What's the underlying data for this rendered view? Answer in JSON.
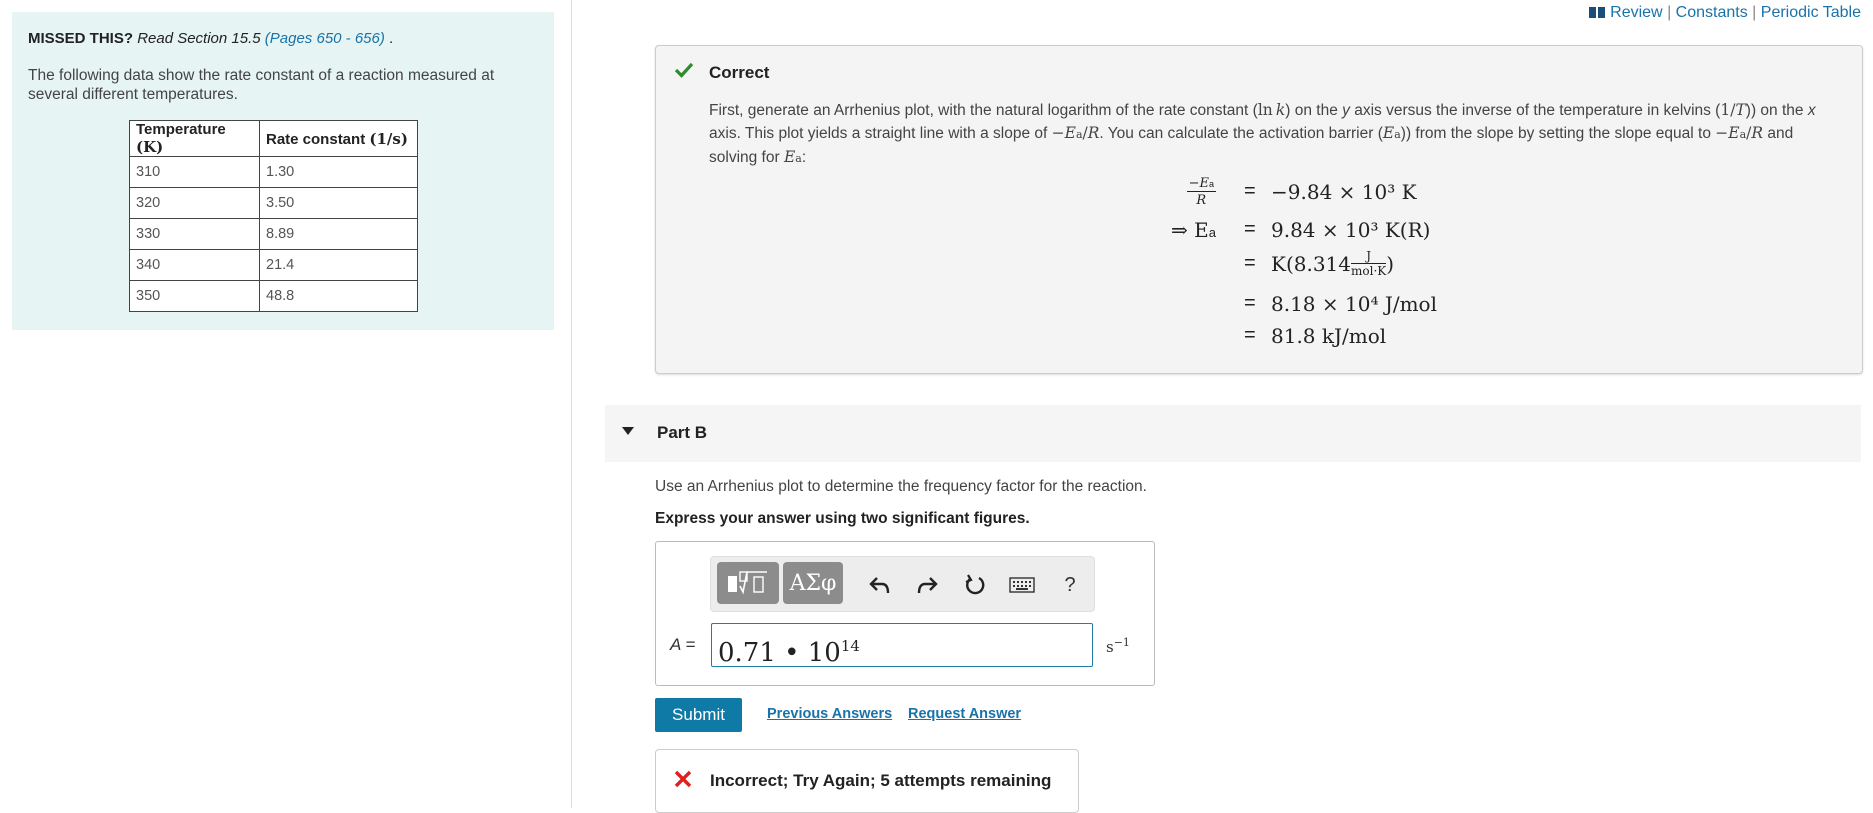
{
  "left": {
    "missed_label": "MISSED THIS?",
    "missed_read": "Read Section 15.5",
    "missed_pages": "(Pages 650 - 656)",
    "missed_trail": ".",
    "intro": "The following data show the rate constant of a reaction measured at several different temperatures.",
    "table": {
      "headers": [
        "Temperature (K)",
        "Rate constant (1/s)"
      ],
      "rows": [
        [
          "310",
          "1.30"
        ],
        [
          "320",
          "3.50"
        ],
        [
          "330",
          "8.89"
        ],
        [
          "340",
          "21.4"
        ],
        [
          "350",
          "48.8"
        ]
      ]
    }
  },
  "top_links": {
    "review": "Review",
    "constants": "Constants",
    "periodic_table": "Periodic Table",
    "sep": "|"
  },
  "feedback": {
    "title": "Correct",
    "explanation_p1": "First, generate an Arrhenius plot, with the natural logarithm of the rate constant (",
    "explanation_p2": ") on the ",
    "explanation_p3": " axis versus the inverse of the temperature in kelvins (",
    "explanation_p4": ") on the ",
    "explanation_p5": " axis. This plot yields a straight line with a slope of ",
    "explanation_p6": ". You can calculate the activation barrier (",
    "explanation_p7": ") from the slope by setting the slope equal to ",
    "explanation_p8": " and solving for ",
    "explanation_p9": ":",
    "equations": [
      {
        "lhs": "",
        "rhs": "−9.84 × 10³ K"
      },
      {
        "lhs": "⇒ E",
        "rhs": "9.84 × 10³ K(R)"
      },
      {
        "lhs": "",
        "rhs": "K(8.314"
      },
      {
        "lhs": "",
        "rhs": "8.18 × 10⁴ J/mol"
      },
      {
        "lhs": "",
        "rhs": "81.8 kJ/mol"
      }
    ]
  },
  "part_b": {
    "title": "Part B",
    "question": "Use an Arrhenius plot to determine the frequency factor for the reaction.",
    "instruction": "Express your answer using two significant figures.",
    "toolbar": {
      "greek": "ΑΣφ",
      "help": "?"
    },
    "answer_label": "A =",
    "answer_mantissa": "0.71 • 10",
    "answer_exp": "14",
    "unit_base": "s",
    "unit_exp": "−1",
    "submit": "Submit",
    "previous_answers": "Previous Answers",
    "request_answer": "Request Answer",
    "result": "Incorrect; Try Again; 5 attempts remaining"
  },
  "colors": {
    "accent": "#0f7aa6",
    "link": "#1a73a8",
    "correct_green": "#2e8b2e",
    "incorrect_red": "#e02020",
    "left_panel_bg": "#e6f4f4"
  }
}
